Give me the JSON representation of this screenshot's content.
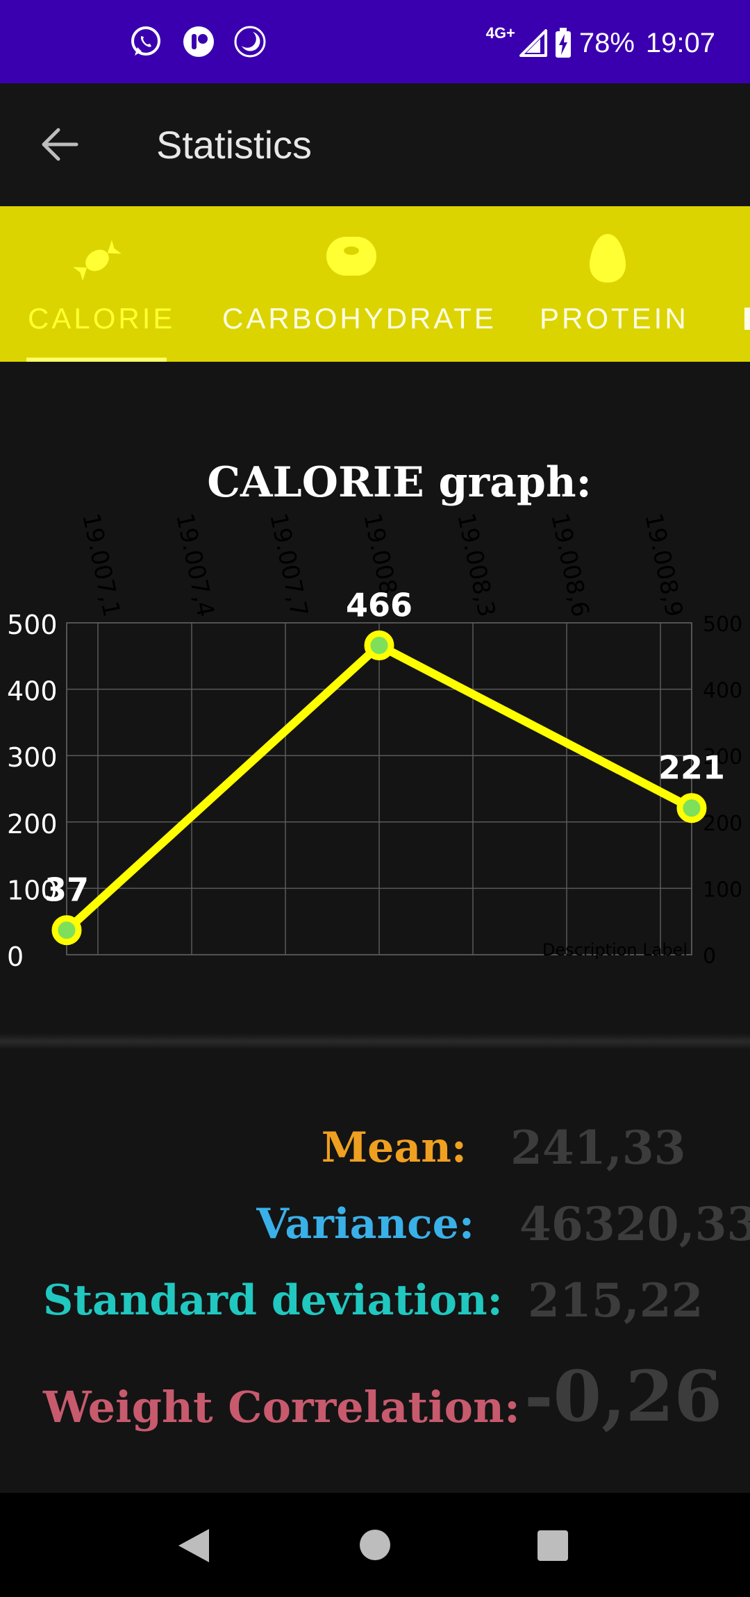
{
  "status_bar": {
    "network": "4G+",
    "battery": "78%",
    "time": "19:07",
    "icons": [
      "whatsapp-icon",
      "notification-app-icon",
      "moon-icon",
      "signal-icon",
      "battery-charging-icon"
    ]
  },
  "app_bar": {
    "title": "Statistics",
    "back_icon": "arrow-left-icon"
  },
  "tabs": [
    {
      "label": "CALORIE",
      "icon": "candy-icon",
      "active": true
    },
    {
      "label": "CARBOHYDRATE",
      "icon": "donut-icon",
      "active": false
    },
    {
      "label": "PROTEIN",
      "icon": "egg-icon",
      "active": false
    }
  ],
  "colors": {
    "status_bar": "#3a00b0",
    "tab_bar": "#dcd400",
    "line": "#ffff00",
    "point_fill": "#7ee05a",
    "mean": "#f0a020",
    "variance": "#3ab0e8",
    "std_dev": "#20c8c0",
    "weight_corr": "#c85a6e"
  },
  "chart_data": {
    "type": "line",
    "title": "CALORIE graph:",
    "x_ticks": [
      "19.007,1",
      "19.007,4",
      "19.007,7",
      "19.008",
      "19.008,3",
      "19.008,6",
      "19.008,9"
    ],
    "x_tick_values": [
      19007.1,
      19007.4,
      19007.7,
      19008.0,
      19008.3,
      19008.6,
      19008.9
    ],
    "xlim": [
      19007.0,
      19009.0
    ],
    "ylim": [
      0,
      500
    ],
    "y_ticks": [
      0,
      100,
      200,
      300,
      400,
      500
    ],
    "y_tick_labels": [
      "0",
      "100",
      "200",
      "300",
      "400",
      "500"
    ],
    "series": [
      {
        "x": [
          19007.0,
          19008.0,
          19009.0
        ],
        "values": [
          37,
          466,
          221
        ],
        "labels": [
          "37",
          "466",
          "221"
        ]
      }
    ],
    "description": "Description Label",
    "grid": true
  },
  "stats": [
    {
      "label": "Mean:",
      "value": "241,33"
    },
    {
      "label": "Variance:",
      "value": "46320,33"
    },
    {
      "label": "Standard deviation:",
      "value": "215,22"
    },
    {
      "label": "Weight Correlation:",
      "value": "-0,26"
    }
  ],
  "nav_bar": {
    "icons": [
      "back-triangle-icon",
      "home-circle-icon",
      "recents-square-icon"
    ]
  }
}
